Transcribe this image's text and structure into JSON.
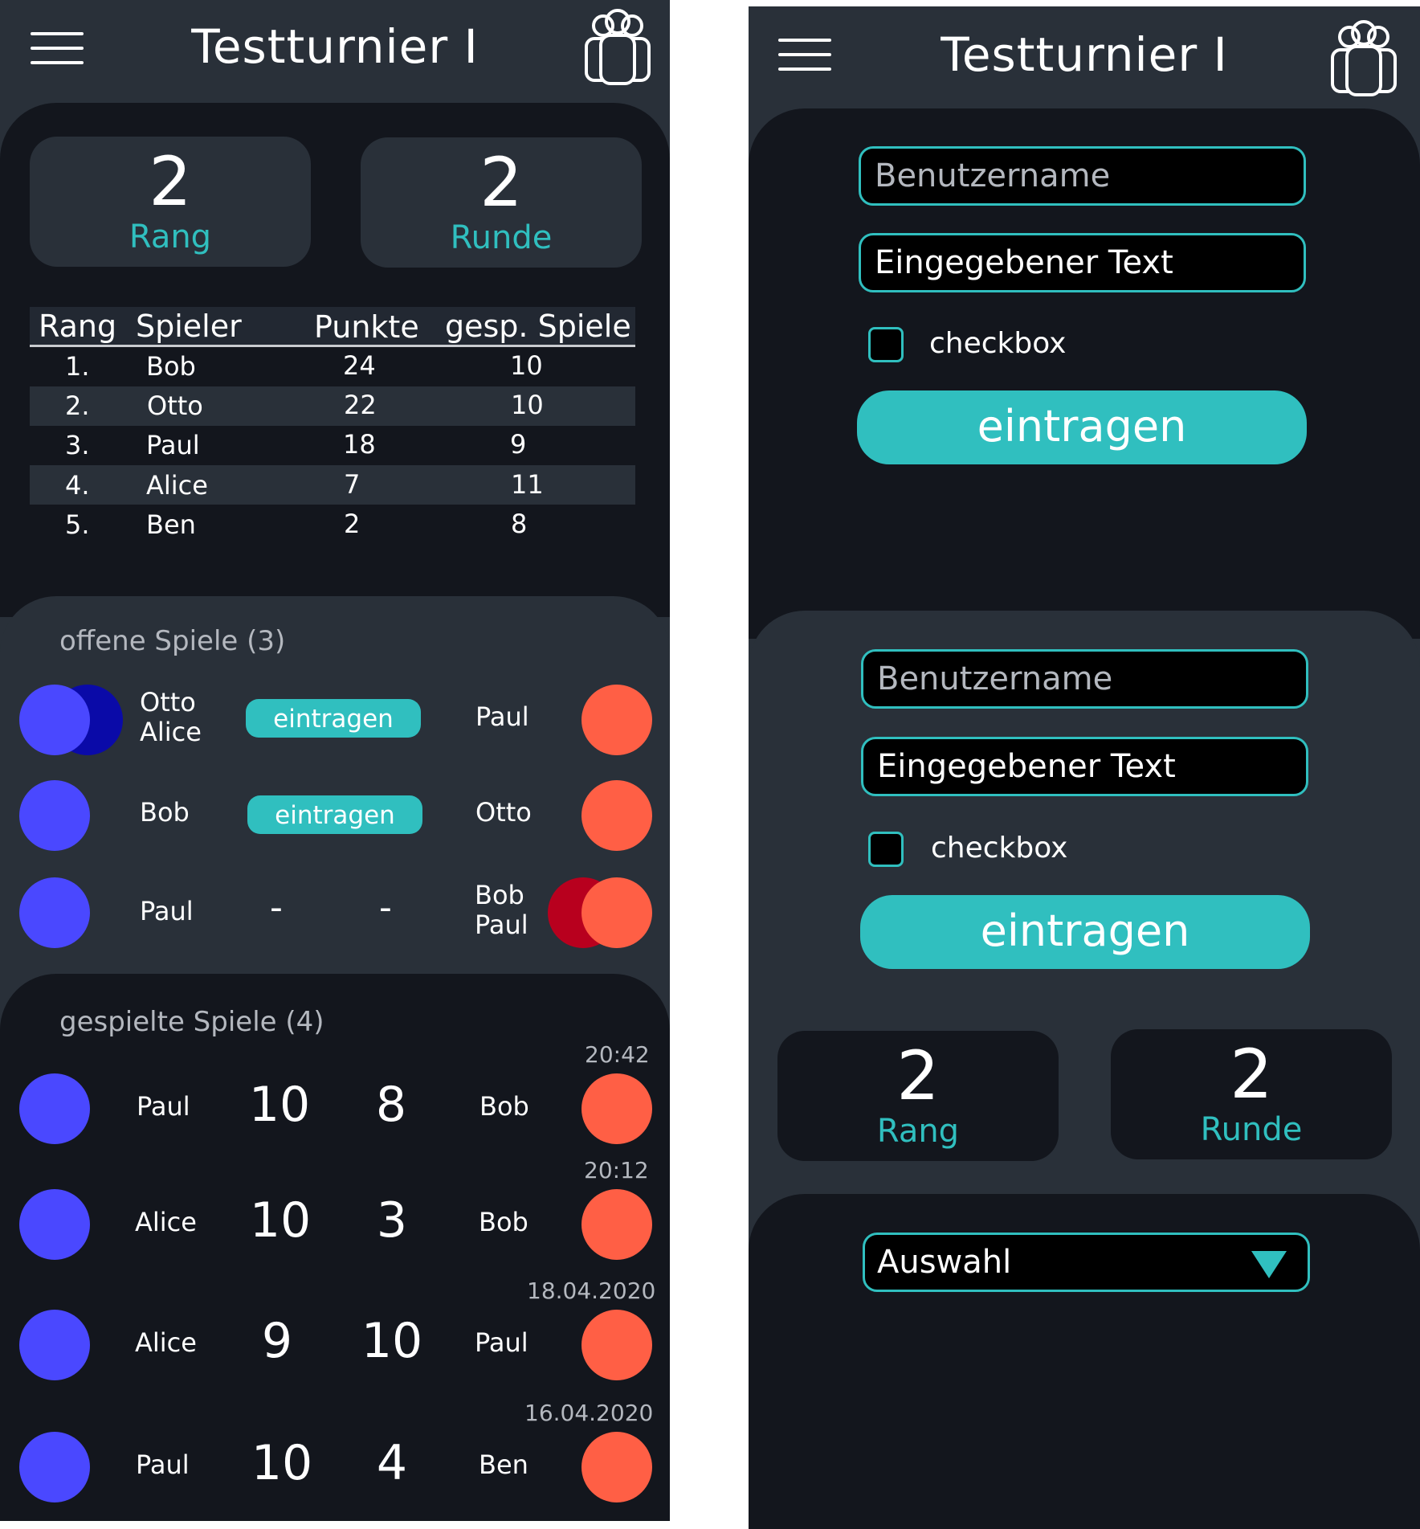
{
  "colors": {
    "accent": "#30bfbf",
    "panel_dark": "#13161d",
    "panel_mid": "#293039",
    "player_a": "#4a48ff",
    "player_b": "#ff5f45"
  },
  "header": {
    "title": "Testturnier I",
    "menu_icon": "hamburger-menu-icon",
    "user_icon": "users-group-icon"
  },
  "stats": {
    "rank_value": "2",
    "rank_label": "Rang",
    "round_value": "2",
    "round_label": "Runde"
  },
  "ranking": {
    "columns": [
      "Rang",
      "Spieler",
      "Punkte",
      "gesp. Spiele"
    ],
    "rows": [
      {
        "rank": "1.",
        "player": "Bob",
        "points": "24",
        "games": "10"
      },
      {
        "rank": "2.",
        "player": "Otto",
        "points": "22",
        "games": "10"
      },
      {
        "rank": "3.",
        "player": "Paul",
        "points": "18",
        "games": "9"
      },
      {
        "rank": "4.",
        "player": "Alice",
        "points": "7",
        "games": "11"
      },
      {
        "rank": "5.",
        "player": "Ben",
        "points": "2",
        "games": "8"
      }
    ]
  },
  "open_games": {
    "title": "offene Spiele (3)",
    "games": [
      {
        "left": "Otto\nAlice",
        "action": "eintragen",
        "right": "Paul"
      },
      {
        "left": "Bob",
        "action": "eintragen",
        "right": "Otto"
      },
      {
        "left": "Paul",
        "score_left": "-",
        "score_right": "-",
        "right": "Bob\nPaul"
      }
    ]
  },
  "played_games": {
    "title": "gespielte Spiele (4)",
    "games": [
      {
        "time": "20:42",
        "left": "Paul",
        "score_left": "10",
        "score_right": "8",
        "right": "Bob"
      },
      {
        "time": "20:12",
        "left": "Alice",
        "score_left": "10",
        "score_right": "3",
        "right": "Bob"
      },
      {
        "time": "18.04.2020",
        "left": "Alice",
        "score_left": "9",
        "score_right": "10",
        "right": "Paul"
      },
      {
        "time": "16.04.2020",
        "left": "Paul",
        "score_left": "10",
        "score_right": "4",
        "right": "Ben"
      }
    ]
  },
  "form": {
    "username_placeholder": "Benutzername",
    "text_value": "Eingegebener Text",
    "checkbox_label": "checkbox",
    "checkbox_checked": false,
    "submit_label": "eintragen"
  },
  "select": {
    "value": "Auswahl",
    "icon": "triangle-down-icon"
  }
}
